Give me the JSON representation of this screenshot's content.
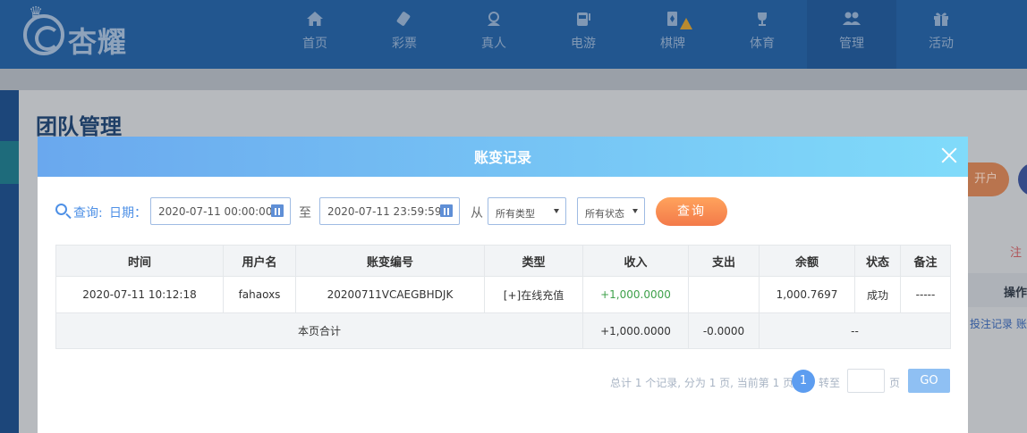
{
  "brand": {
    "name": "杏耀"
  },
  "nav": {
    "items": [
      {
        "label": "首页",
        "icon": "home-icon"
      },
      {
        "label": "彩票",
        "icon": "lottery-icon"
      },
      {
        "label": "真人",
        "icon": "live-dealer-icon"
      },
      {
        "label": "电游",
        "icon": "slot-machine-icon"
      },
      {
        "label": "棋牌",
        "icon": "card-game-icon"
      },
      {
        "label": "体育",
        "icon": "trophy-icon"
      },
      {
        "label": "管理",
        "icon": "users-icon"
      },
      {
        "label": "活动",
        "icon": "gift-icon"
      }
    ],
    "active": "管理"
  },
  "page": {
    "title": "团队管理",
    "button_partial": "开户",
    "note_partial": "注",
    "table_header_partial": "操作",
    "links_partial": "投注记录 账"
  },
  "modal": {
    "title": "账变记录",
    "filter": {
      "query_label": "查询:",
      "date_label": "日期：",
      "start_date": "2020-07-11 00:00:00",
      "to_label": "至",
      "end_date": "2020-07-11 23:59:59",
      "from_label": "从",
      "type_select": "所有类型",
      "status_select": "所有状态",
      "query_button": "查询"
    },
    "table": {
      "headers": [
        "时间",
        "用户名",
        "账变编号",
        "类型",
        "收入",
        "支出",
        "余额",
        "状态",
        "备注"
      ],
      "rows": [
        {
          "time": "2020-07-11 10:12:18",
          "username": "fahaoxs",
          "serial": "20200711VCAEGBHDJK",
          "type": "[+]在线充值",
          "income": "+1,000.0000",
          "expense": "",
          "balance": "1,000.7697",
          "status": "成功",
          "remark": "-----"
        }
      ],
      "summary": {
        "label": "本页合计",
        "income": "+1,000.0000",
        "expense": "-0.0000",
        "balance": "--"
      }
    },
    "pagination": {
      "summary": "总计 1 个记录, 分为 1 页, 当前第 1 页",
      "current_page": "1",
      "goto_label": "转至",
      "page_unit": "页",
      "go_button": "GO"
    }
  },
  "colors": {
    "navbar": "#22568f",
    "modal_header_start": "#6aa8ee",
    "modal_header_end": "#80dbfa",
    "query_button": "#f37a4a",
    "income_positive": "#3fa14b",
    "go_button": "#8fc0f3"
  }
}
